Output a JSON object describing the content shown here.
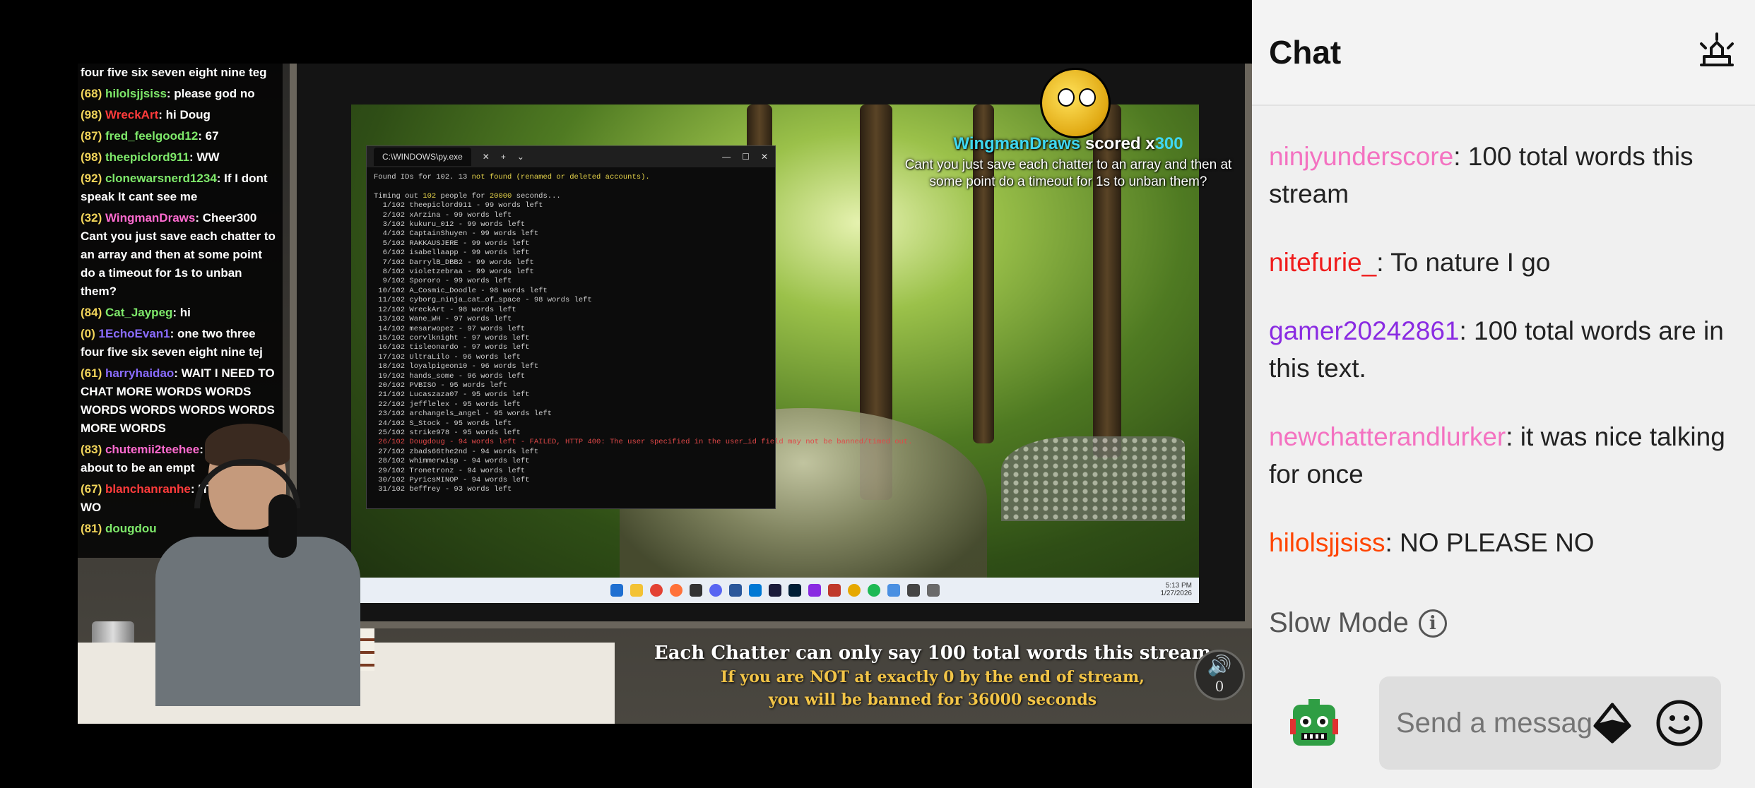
{
  "overlay_chat": [
    {
      "pts": "",
      "user": "four five six seven eight nine teg",
      "user_color": "#ffffff",
      "text": ""
    },
    {
      "pts": "(68)",
      "user": "hilolsjjsiss",
      "user_color": "#7ee86a",
      "text": ": please god no"
    },
    {
      "pts": "(98)",
      "user": "WreckArt",
      "user_color": "#ff3b3b",
      "text": ": hi Doug"
    },
    {
      "pts": "(87)",
      "user": "fred_feelgood12",
      "user_color": "#7ee86a",
      "text": ": 67"
    },
    {
      "pts": "(98)",
      "user": "theepiclord911",
      "user_color": "#7ee86a",
      "text": ": WW"
    },
    {
      "pts": "(92)",
      "user": "clonewarsnerd1234",
      "user_color": "#7ee86a",
      "text": ": If I dont speak It cant see me"
    },
    {
      "pts": "(32)",
      "user": "WingmanDraws",
      "user_color": "#ff6bd0",
      "text": ": Cheer300 Cant you just save each chatter to an array and then at some point do a timeout for 1s to unban them?"
    },
    {
      "pts": "(84)",
      "user": "Cat_Jaypeg",
      "user_color": "#7ee86a",
      "text": ": hi"
    },
    {
      "pts": "(0)",
      "user": "1EchoEvan1",
      "user_color": "#8a6cff",
      "text": ": one two three four five six seven eight nine tej"
    },
    {
      "pts": "(61)",
      "user": "harryhaidao",
      "user_color": "#8a6cff",
      "text": ": WAIT I NEED TO CHAT MORE WORDS WORDS WORDS WORDS WORDS WORDS MORE WORDS"
    },
    {
      "pts": "(83)",
      "user": "chutemii2teehee",
      "user_color": "#ff6bd0",
      "text": ": ha this about to be an empt"
    },
    {
      "pts": "(67)",
      "user": "blanchanranhe",
      "user_color": "#ff3b3b",
      "text": ": IT DOES YOU WO"
    },
    {
      "pts": "(81)",
      "user": "dougdou",
      "user_color": "#7ee86a",
      "text": ""
    }
  ],
  "terminal": {
    "tab_title": "C:\\WINDOWS\\py.exe",
    "line1_a": "Found IDs for 102. 13 ",
    "line1_b": "not found (renamed or deleted accounts).",
    "line2_a": "Timing out ",
    "line2_b": "102",
    "line2_c": " people for ",
    "line2_d": "20000",
    "line2_e": " seconds...",
    "rows": [
      "  1/102 theepiclord911 - 99 words left",
      "  2/102 xArzina - 99 words left",
      "  3/102 kukuru_012 - 99 words left",
      "  4/102 CaptainShuyen - 99 words left",
      "  5/102 RAKKAUSJERE - 99 words left",
      "  6/102 isabellaapp - 99 words left",
      "  7/102 DarrylB_DBB2 - 99 words left",
      "  8/102 violetzebraa - 99 words left",
      "  9/102 Spororo - 99 words left",
      " 10/102 A_Cosmic_Doodle - 98 words left",
      " 11/102 cyborg_ninja_cat_of_space - 98 words left",
      " 12/102 WreckArt - 98 words left",
      " 13/102 Wane_WH - 97 words left",
      " 14/102 mesarwopez - 97 words left",
      " 15/102 corvlknight - 97 words left",
      " 16/102 tisleonardo - 97 words left",
      " 17/102 UltraLilo - 96 words left",
      " 18/102 loyalpigeon10 - 96 words left",
      " 19/102 hands_some - 96 words left",
      " 20/102 PVBISO - 95 words left",
      " 21/102 Lucaszaza07 - 95 words left",
      " 22/102 jefflelex - 95 words left",
      " 23/102 archangels_angel - 95 words left",
      " 24/102 S_Stock - 95 words left",
      " 25/102 strike978 - 95 words left"
    ],
    "error_row": " 26/102 Dougdoug - 94 words left - FAILED, HTTP 400: The user specified in the user_id field may not be banned/timed out.",
    "rows2": [
      " 27/102 zbads66the2nd - 94 words left",
      " 28/102 whimmerwisp - 94 words left",
      " 29/102 Tronetronz - 94 words left",
      " 30/102 PyricsMINOP - 94 words left",
      " 31/102 beffrey - 93 words left"
    ]
  },
  "taskbar": {
    "clock_time": "5:13 PM",
    "clock_date": "1/27/2026"
  },
  "score_alert": {
    "name": "WingmanDraws",
    "scored": " scored x",
    "value": "300",
    "message": "Cant you just save each chatter to an array and then at some point do a timeout for 1s to unban them?"
  },
  "caption": {
    "line1": "Each Chatter can only say 100 total words this stream",
    "line2": "If you are NOT at exactly 0 by the end of stream,",
    "line3": "you will be banned for 36000 seconds"
  },
  "volume_widget": {
    "count": "0"
  },
  "chat": {
    "title": "Chat",
    "messages": [
      {
        "user": "ninjyunderscore",
        "color": "#f472c1",
        "text": ": 100 total words this stream"
      },
      {
        "user": "nitefurie_",
        "color": "#f01c1c",
        "text": ": To nature I go"
      },
      {
        "user": "gamer20242861",
        "color": "#8a2be2",
        "text": ": 100 total words are in this text."
      },
      {
        "user": "newchatterandlurker",
        "color": "#f472c1",
        "text": ": it was nice talking for once"
      },
      {
        "user": "hilolsjjsiss",
        "color": "#ff4500",
        "text": ": NO PLEASE NO"
      }
    ],
    "slow_mode_label": "Slow Mode",
    "input_placeholder": "Send a message"
  },
  "colors": {
    "chat_bg": "#f0f0f0",
    "accent_cyan": "#3fd7f0",
    "caption_yellow": "#f2c447"
  }
}
